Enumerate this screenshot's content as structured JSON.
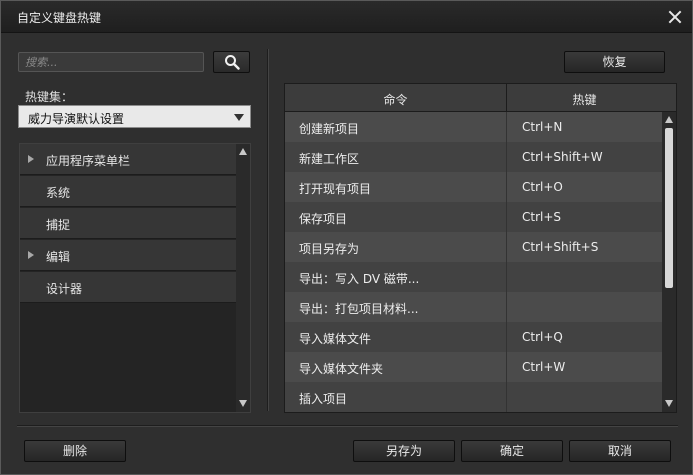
{
  "window": {
    "title": "自定义键盘热键"
  },
  "search": {
    "placeholder": "搜索..."
  },
  "hotkey_set": {
    "label": "热键集：",
    "selected": "威力导演默认设置"
  },
  "tree": {
    "items": [
      {
        "label": "应用程序菜单栏",
        "expandable": true
      },
      {
        "label": "系统",
        "expandable": false
      },
      {
        "label": "捕捉",
        "expandable": false
      },
      {
        "label": "编辑",
        "expandable": true
      },
      {
        "label": "设计器",
        "expandable": false
      }
    ]
  },
  "buttons": {
    "restore": "恢复",
    "delete": "删除",
    "save_as": "另存为",
    "ok": "确定",
    "cancel": "取消"
  },
  "table": {
    "headers": {
      "command": "命令",
      "hotkey": "热键"
    },
    "rows": [
      {
        "command": "创建新项目",
        "hotkey": "Ctrl+N"
      },
      {
        "command": "新建工作区",
        "hotkey": "Ctrl+Shift+W"
      },
      {
        "command": "打开现有项目",
        "hotkey": "Ctrl+O"
      },
      {
        "command": "保存项目",
        "hotkey": "Ctrl+S"
      },
      {
        "command": "项目另存为",
        "hotkey": "Ctrl+Shift+S"
      },
      {
        "command": "导出：写入 DV 磁带...",
        "hotkey": ""
      },
      {
        "command": "导出：打包项目材料...",
        "hotkey": ""
      },
      {
        "command": "导入媒体文件",
        "hotkey": "Ctrl+Q"
      },
      {
        "command": "导入媒体文件夹",
        "hotkey": "Ctrl+W"
      },
      {
        "command": "插入项目",
        "hotkey": ""
      }
    ]
  },
  "icons": {
    "search": "magnifier-icon",
    "close": "close-icon",
    "dropdown": "chevron-down-icon"
  }
}
